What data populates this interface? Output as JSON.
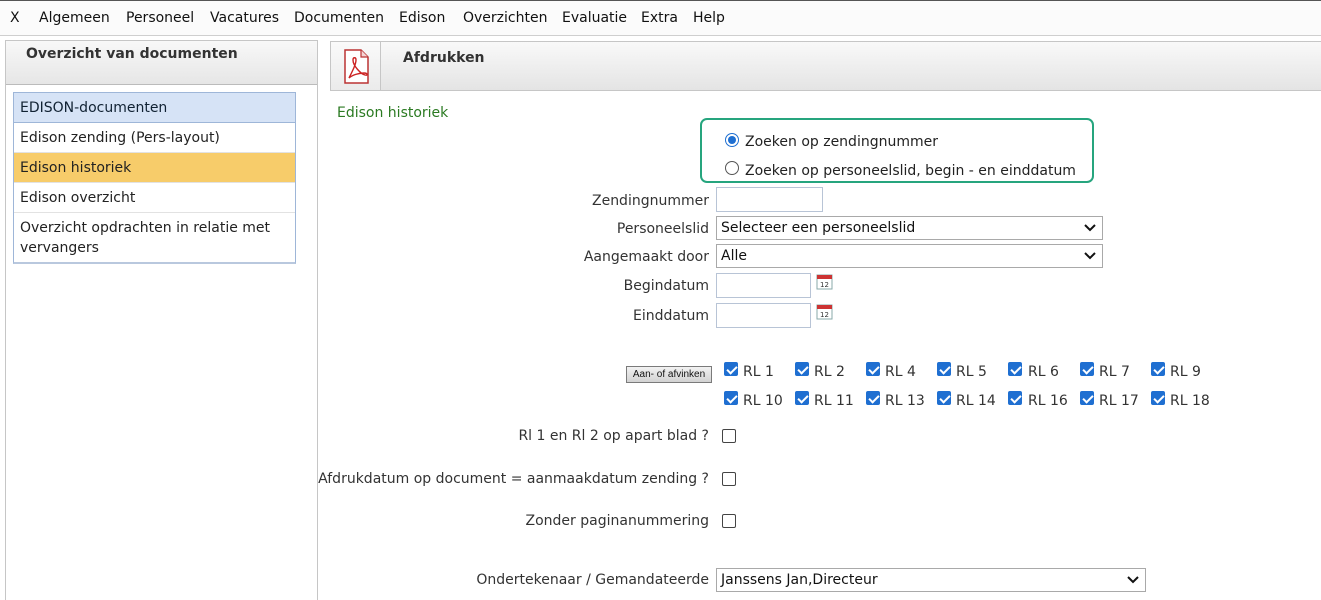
{
  "menu": [
    "X",
    "Algemeen",
    "Personeel",
    "Vacatures",
    "Documenten",
    "Edison",
    "Overzichten",
    "Evaluatie",
    "Extra",
    "Help"
  ],
  "left": {
    "title": "Overzicht van documenten",
    "items": [
      {
        "label": "EDISON-documenten"
      },
      {
        "label": "Edison zending (Pers-layout)"
      },
      {
        "label": "Edison historiek"
      },
      {
        "label": "Edison overzicht"
      },
      {
        "label": "Overzicht opdrachten in relatie met vervangers"
      }
    ]
  },
  "main": {
    "title": "Afdrukken",
    "section": "Edison historiek",
    "radio": {
      "option1": "Zoeken op zendingnummer",
      "option2": "Zoeken op personeelslid, begin - en einddatum",
      "selected": 1
    },
    "form": {
      "zendingnummer_label": "Zendingnummer",
      "zendingnummer_value": "",
      "personeelslid_label": "Personeelslid",
      "personeelslid_value": "Selecteer een personeelslid",
      "aangemaakt_label": "Aangemaakt door",
      "aangemaakt_value": "Alle",
      "begindatum_label": "Begindatum",
      "begindatum_value": "",
      "einddatum_label": "Einddatum",
      "einddatum_value": ""
    },
    "toggle_button": "Aan- of afvinken",
    "rl_row1": [
      "RL 1",
      "RL 2",
      "RL 4",
      "RL 5",
      "RL 6",
      "RL 7",
      "RL 9"
    ],
    "rl_row2": [
      "RL 10",
      "RL 11",
      "RL 13",
      "RL 14",
      "RL 16",
      "RL 17",
      "RL 18"
    ],
    "options": {
      "opt1": "Rl 1 en Rl 2 op apart blad ?",
      "opt2": "Afdrukdatum op document = aanmaakdatum zending ?",
      "opt3": "Zonder paginanummering"
    },
    "signer_label": "Ondertekenaar / Gemandateerde",
    "signer_value": "Janssens Jan,Directeur"
  },
  "colors": {
    "accent_blue": "#1f6fd1",
    "highlight_orange": "#f7cc6a",
    "section_green": "#2b7a22",
    "callout_teal": "#26a57e"
  }
}
